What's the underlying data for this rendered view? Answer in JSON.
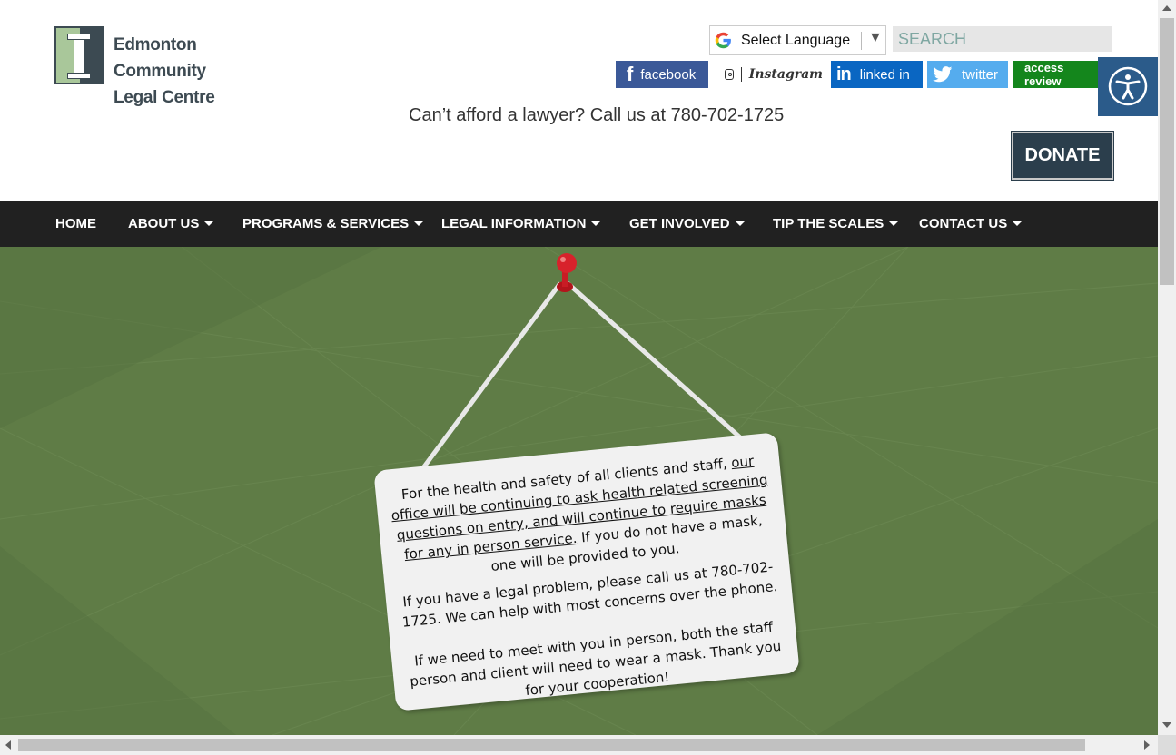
{
  "header": {
    "logo": {
      "line1": "Edmonton Community",
      "line2": "Legal Centre",
      "icon": "pillar-logo-icon"
    },
    "language": {
      "label": "Select Language",
      "icon": "google-g-icon",
      "arrow": "▼"
    },
    "search": {
      "placeholder": "SEARCH"
    },
    "social": {
      "facebook": "facebook",
      "instagram": "Instagram",
      "linkedin": "linked in",
      "twitter": "twitter",
      "access_review": "access review"
    },
    "tagline": "Can’t afford a lawyer? Call us at 780-702-1725",
    "donate": "DONATE"
  },
  "nav": {
    "items": [
      {
        "label": "HOME",
        "dropdown": false
      },
      {
        "label": "ABOUT US",
        "dropdown": true
      },
      {
        "label": "PROGRAMS & SERVICES",
        "dropdown": true
      },
      {
        "label": "LEGAL INFORMATION",
        "dropdown": true
      },
      {
        "label": "GET INVOLVED",
        "dropdown": true
      },
      {
        "label": "TIP THE SCALES",
        "dropdown": true
      },
      {
        "label": "CONTACT US",
        "dropdown": true
      }
    ]
  },
  "notice": {
    "p1_a": "For the health and safety of all clients and staff,",
    "p1_u": "our office will be continuing to ask health related screening questions on entry, and will continue to require masks for any in person service.",
    "p1_b": "If you do not have a mask, one will be provided to you.",
    "p2": "If you have a legal problem, please call us at 780-702-1725. We can help with most concerns over the phone.",
    "p3": "If we need to meet with you in person, both the staff person and client will need to wear a mask. Thank you for your cooperation!"
  },
  "colors": {
    "hero_bg": "#5f7c46",
    "nav_bg": "#212121",
    "donate_bg": "#2b3e4c",
    "facebook": "#3b5998",
    "linkedin": "#0a66c2",
    "twitter": "#55acee",
    "access_review": "#14861c",
    "accessibility_button": "#2b5b8a"
  }
}
